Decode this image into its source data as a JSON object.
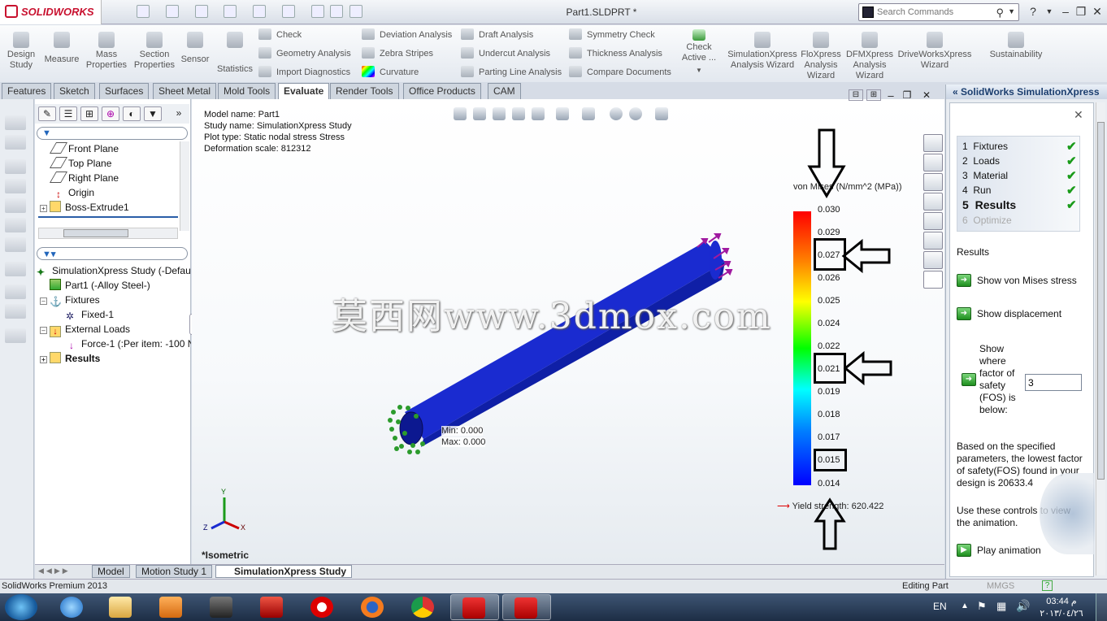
{
  "app": {
    "brand": "SOLIDWORKS",
    "doc_title": "Part1.SLDPRT *"
  },
  "search": {
    "placeholder": "Search Commands"
  },
  "ribbon": {
    "big": [
      {
        "label": "Design\nStudy"
      },
      {
        "label": "Measure"
      },
      {
        "label": "Mass\nProperties"
      },
      {
        "label": "Section\nProperties"
      },
      {
        "label": "Sensor"
      },
      {
        "label": "Statistics"
      }
    ],
    "col1": [
      "Check",
      "Geometry Analysis",
      "Import Diagnostics"
    ],
    "col2": [
      "Deviation Analysis",
      "Zebra Stripes",
      "Curvature"
    ],
    "col3": [
      "Draft Analysis",
      "Undercut Analysis",
      "Parting Line Analysis"
    ],
    "col4": [
      "Symmetry Check",
      "Thickness Analysis",
      "Compare Documents"
    ],
    "check_active": "Check\nActive ...",
    "big2": [
      {
        "label": "SimulationXpress\nAnalysis Wizard"
      },
      {
        "label": "FloXpress\nAnalysis\nWizard"
      },
      {
        "label": "DFMXpress\nAnalysis\nWizard"
      },
      {
        "label": "DriveWorksXpress\nWizard"
      },
      {
        "label": "Sustainability"
      }
    ]
  },
  "tabs": [
    "Features",
    "Sketch",
    "Surfaces",
    "Sheet Metal",
    "Mold Tools",
    "Evaluate",
    "Render Tools",
    "Office Products",
    "CAM"
  ],
  "feature_tree": [
    "Front Plane",
    "Top Plane",
    "Right Plane",
    "Origin",
    "Boss-Extrude1"
  ],
  "sim_tree": {
    "study": "SimulationXpress Study (-Defaul",
    "part": "Part1 (-Alloy Steel-)",
    "fixtures": "Fixtures",
    "fixed": "Fixed-1",
    "loads": "External Loads",
    "force": "Force-1 (:Per item: -100 N",
    "results": "Results"
  },
  "plot_info": [
    "Model name: Part1",
    "Study name: SimulationXpress Study",
    "Plot type: Static nodal stress Stress",
    "Deformation scale: 812312"
  ],
  "legend": {
    "title": "von Mises (N/mm^2 (MPa))",
    "ticks": [
      "0.030",
      "0.029",
      "0.027",
      "0.026",
      "0.025",
      "0.024",
      "0.022",
      "0.021",
      "0.019",
      "0.018",
      "0.017",
      "0.015",
      "0.014"
    ],
    "yield": "Yield strength: 620.422"
  },
  "minmax": {
    "min": "Min: 0.000",
    "max": "Max: 0.000"
  },
  "view_label": "*Isometric",
  "watermark": "莫西网www.3dmox.com",
  "sim_panel": {
    "title": "SolidWorks SimulationXpress",
    "steps": [
      {
        "n": "1",
        "label": "Fixtures"
      },
      {
        "n": "2",
        "label": "Loads"
      },
      {
        "n": "3",
        "label": "Material"
      },
      {
        "n": "4",
        "label": "Run"
      },
      {
        "n": "5",
        "label": "Results"
      },
      {
        "n": "6",
        "label": "Optimize"
      }
    ],
    "results_heading": "Results",
    "show_vm": "Show von Mises stress",
    "show_disp": "Show displacement",
    "show_fos": "Show\nwhere\nfactor of\nsafety\n(FOS) is\nbelow:",
    "fos_value": "3",
    "fos_text": "Based on the specified parameters, the lowest factor of safety(FOS) found in your design is 20633.4",
    "anim_text": "Use these controls to view the animation.",
    "play": "Play animation"
  },
  "bottom_tabs": [
    "Model",
    "Motion Study 1",
    "SimulationXpress Study"
  ],
  "status": {
    "left": "SolidWorks Premium 2013",
    "right": "Editing Part",
    "units": "MMGS"
  },
  "taskbar": {
    "lang": "EN",
    "time": "03:44 م",
    "date": "٢٠١٣/٠٤/٢٦"
  }
}
